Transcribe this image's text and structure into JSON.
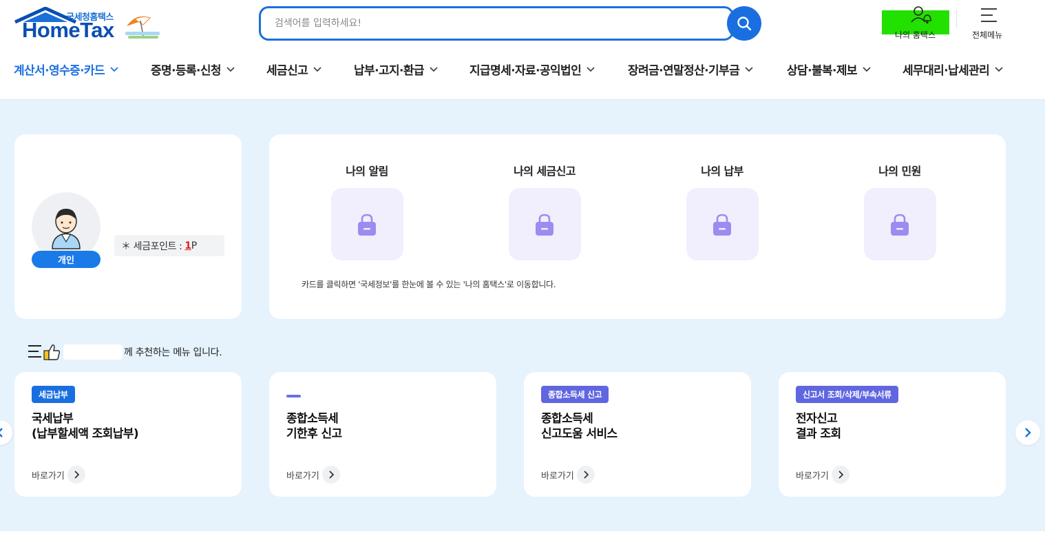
{
  "header": {
    "logo_sub": "국세청홈택스",
    "logo_main": "HomeTax",
    "search_placeholder": "검색어를 입력하세요!",
    "my_hometax_label": "나의 홈택스",
    "all_menu_label": "전체메뉴"
  },
  "nav": {
    "items": [
      {
        "label": "계산서·영수증·카드",
        "active": true
      },
      {
        "label": "증명·등록·신청"
      },
      {
        "label": "세금신고"
      },
      {
        "label": "납부·고지·환급"
      },
      {
        "label": "지급명세·자료·공익법인"
      },
      {
        "label": "장려금·연말정산·기부금"
      },
      {
        "label": "상담·불복·제보"
      },
      {
        "label": "세무대리·납세관리"
      }
    ]
  },
  "profile": {
    "badge": "개인",
    "points_label": "＊ 세금포인트 :",
    "points_value": "1",
    "points_unit": "P"
  },
  "my_info": {
    "tiles": [
      {
        "title": "나의 알림",
        "icon": "lock-icon"
      },
      {
        "title": "나의 세금신고",
        "icon": "lock-icon"
      },
      {
        "title": "나의 납부",
        "icon": "lock-icon"
      },
      {
        "title": "나의 민원",
        "icon": "lock-icon"
      }
    ],
    "notice": "카드를 클릭하면 '국세정보'를 한눈에 볼 수 있는 '나의 홈택스'로 이동합니다."
  },
  "recommend": {
    "heading_suffix": "께 추천하는 메뉴 입니다.",
    "cards": [
      {
        "tag": "세금납부",
        "tag_color": "#1a6fe0",
        "title": "국세납부\n(납부할세액 조회납부)",
        "link": "바로가기"
      },
      {
        "tag": "",
        "title": "종합소득세\n기한후 신고",
        "link": "바로가기"
      },
      {
        "tag": "종합소득세 신고",
        "tag_color": "#6066e0",
        "title": "종합소득세\n신고도움 서비스",
        "link": "바로가기"
      },
      {
        "tag": "신고서 조회/삭제/부속서류",
        "tag_color": "#6066e0",
        "title": "전자신고\n결과 조회",
        "link": "바로가기"
      }
    ]
  },
  "colors": {
    "accent": "#1a6fe0",
    "background": "#e6f2fc",
    "lock": "#9b8cf0"
  }
}
